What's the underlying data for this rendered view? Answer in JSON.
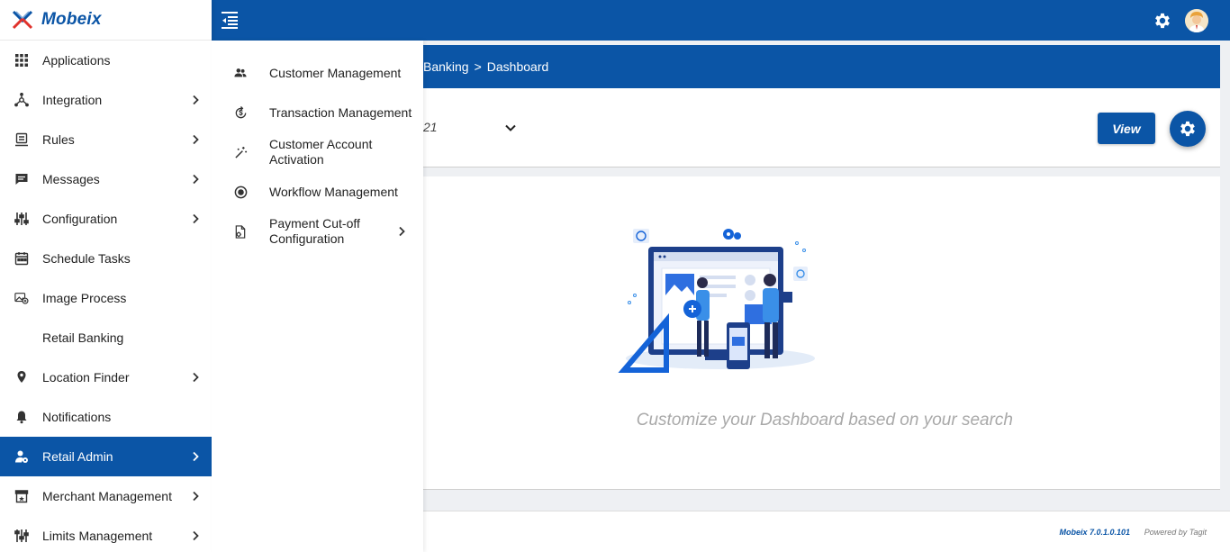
{
  "app": {
    "brand": "Mobeix"
  },
  "sidebar": {
    "items": [
      {
        "label": "Applications",
        "icon": "grid-icon",
        "has_submenu": false
      },
      {
        "label": "Integration",
        "icon": "integration-icon",
        "has_submenu": true
      },
      {
        "label": "Rules",
        "icon": "rules-icon",
        "has_submenu": true
      },
      {
        "label": "Messages",
        "icon": "message-icon",
        "has_submenu": true
      },
      {
        "label": "Configuration",
        "icon": "sliders-icon",
        "has_submenu": true
      },
      {
        "label": "Schedule Tasks",
        "icon": "calendar-icon",
        "has_submenu": false
      },
      {
        "label": "Image Process",
        "icon": "image-process-icon",
        "has_submenu": false
      },
      {
        "label": "Retail Banking",
        "icon": "",
        "has_submenu": false
      },
      {
        "label": "Location Finder",
        "icon": "location-pin-icon",
        "has_submenu": true
      },
      {
        "label": "Notifications",
        "icon": "bell-icon",
        "has_submenu": false
      },
      {
        "label": "Retail Admin",
        "icon": "user-admin-icon",
        "has_submenu": true,
        "active": true
      },
      {
        "label": "Merchant Management",
        "icon": "store-icon",
        "has_submenu": true
      },
      {
        "label": "Limits Management",
        "icon": "sliders-icon",
        "has_submenu": true
      }
    ]
  },
  "flyout": {
    "items": [
      {
        "label": "Customer Management",
        "icon": "people-icon"
      },
      {
        "label": "Transaction Management",
        "icon": "money-transfer-icon"
      },
      {
        "label": "Customer Account Activation",
        "icon": "magic-wand-icon"
      },
      {
        "label": "Workflow Management",
        "icon": "workflow-icon"
      },
      {
        "label": "Payment Cut-off Configuration",
        "icon": "file-settings-icon",
        "has_submenu": true
      }
    ]
  },
  "breadcrumb": {
    "items": [
      "Banking",
      "Dashboard"
    ],
    "separator": ">"
  },
  "filter": {
    "date_value": "21",
    "view_label": "View"
  },
  "content": {
    "empty_message": "Customize your Dashboard based on your search"
  },
  "footer": {
    "version": "Mobeix 7.0.1.0.101",
    "powered_by": "Powered by Tagit"
  },
  "colors": {
    "primary": "#0b55a6",
    "background": "#eef0f3",
    "muted_text": "#a9a9a9"
  }
}
